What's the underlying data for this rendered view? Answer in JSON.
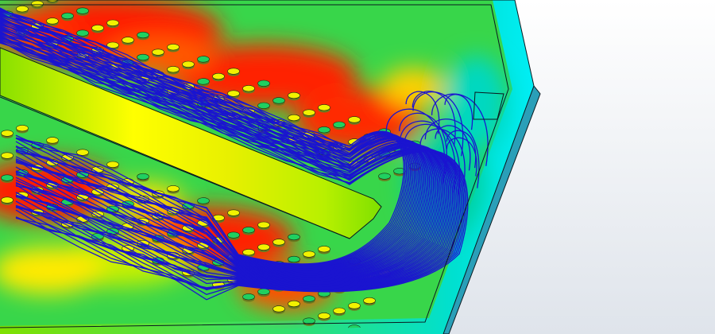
{
  "viewport": {
    "background_top": "#ffffff",
    "background_bottom": "#dfe4eb"
  },
  "colormap": {
    "stops": [
      "#0000ff",
      "#00e5ff",
      "#00d060",
      "#7fe000",
      "#ffff00",
      "#ff9900",
      "#ff1a00"
    ]
  },
  "plate": {
    "edge_color": "#2a9fb8",
    "rim_color": "#00e8f0",
    "outline_color": "#0a1a20"
  },
  "flow_trajectories": {
    "color": "#1a14d0",
    "count": 48
  },
  "pin_fins": {
    "rows": 11,
    "cols": 14,
    "top_color": "#f2f200",
    "cool_color": "#20d060"
  }
}
